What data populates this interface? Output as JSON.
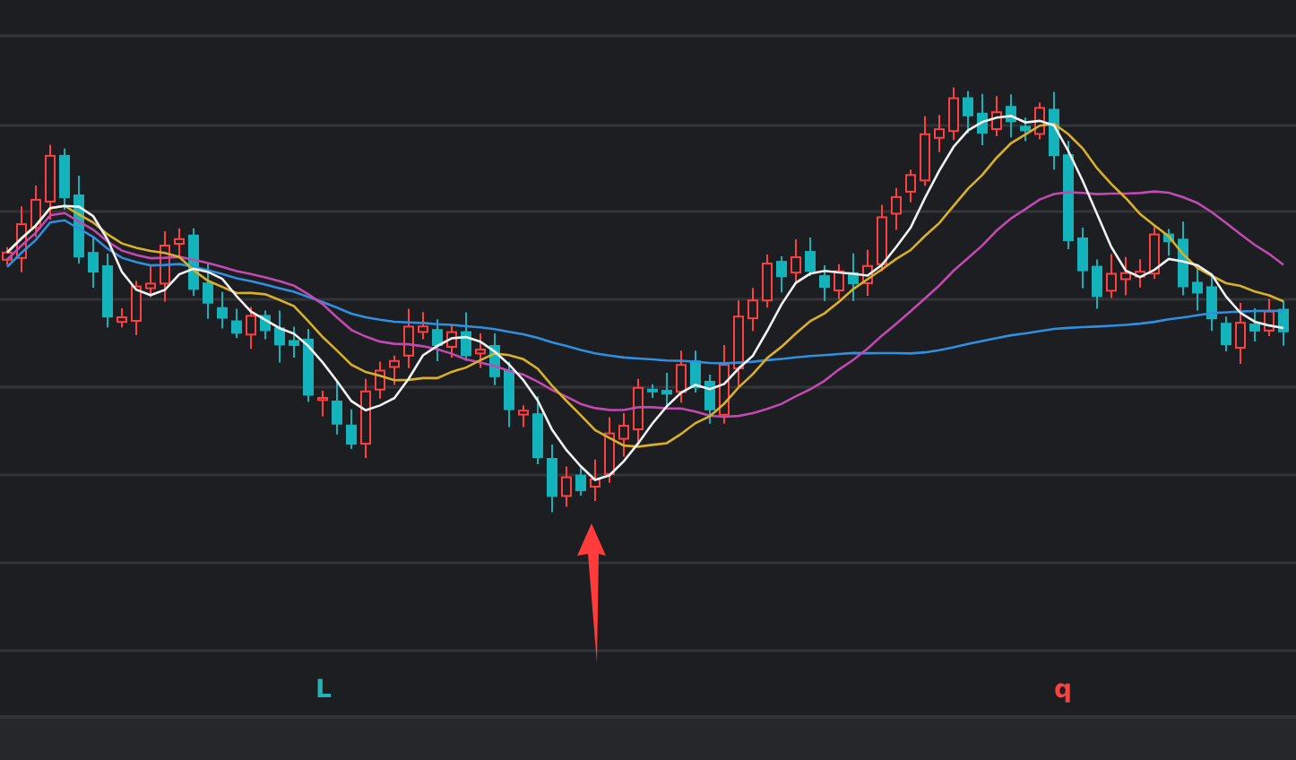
{
  "chart": {
    "markers": [
      {
        "label": "L",
        "color": "#1fb5b5"
      },
      {
        "label": "q",
        "color": "#ff4040"
      }
    ]
  }
}
